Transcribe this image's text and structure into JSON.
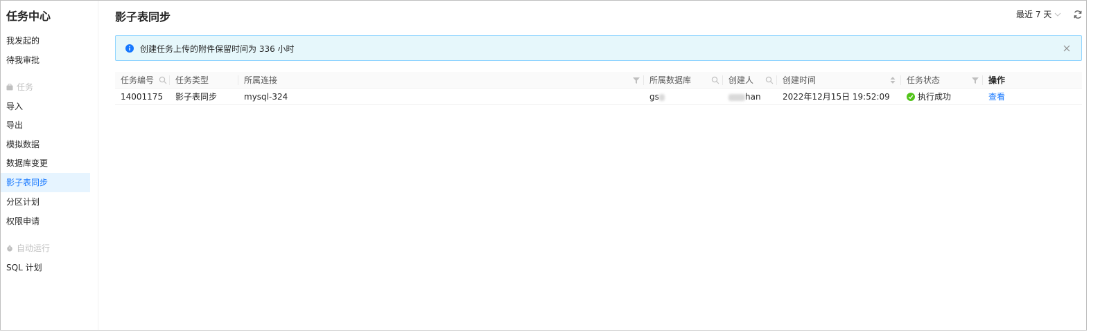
{
  "sidebar": {
    "title": "任务中心",
    "top_items": [
      {
        "label": "我发起的"
      },
      {
        "label": "待我审批"
      }
    ],
    "group_tasks": {
      "label": "任务",
      "icon": "briefcase-icon"
    },
    "task_items": [
      {
        "label": "导入"
      },
      {
        "label": "导出"
      },
      {
        "label": "模拟数据"
      },
      {
        "label": "数据库变更"
      },
      {
        "label": "影子表同步",
        "active": true
      },
      {
        "label": "分区计划"
      },
      {
        "label": "权限申请"
      }
    ],
    "group_auto": {
      "label": "自动运行",
      "icon": "timer-icon"
    },
    "auto_items": [
      {
        "label": "SQL 计划"
      }
    ]
  },
  "header": {
    "title": "影子表同步",
    "range_label": "最近 7 天",
    "refresh_icon": "refresh-icon"
  },
  "alert": {
    "message": "创建任务上传的附件保留时间为 336 小时",
    "icon": "info-icon"
  },
  "table": {
    "columns": [
      {
        "label": "任务编号"
      },
      {
        "label": "任务类型"
      },
      {
        "label": "所属连接"
      },
      {
        "label": "所属数据库"
      },
      {
        "label": "创建人"
      },
      {
        "label": "创建时间"
      },
      {
        "label": "任务状态"
      },
      {
        "label": "操作"
      }
    ],
    "rows": [
      {
        "id": "14001175",
        "type": "影子表同步",
        "connection": "mysql-324",
        "database_prefix": "gs",
        "creator_suffix": "han",
        "created_at": "2022年12月15日 19:52:09",
        "status": "执行成功",
        "action": "查看"
      }
    ]
  },
  "colors": {
    "accent": "#1677ff",
    "success": "#52c41a",
    "alert_bg": "#e6f7fb",
    "alert_border": "#91d5ff"
  }
}
